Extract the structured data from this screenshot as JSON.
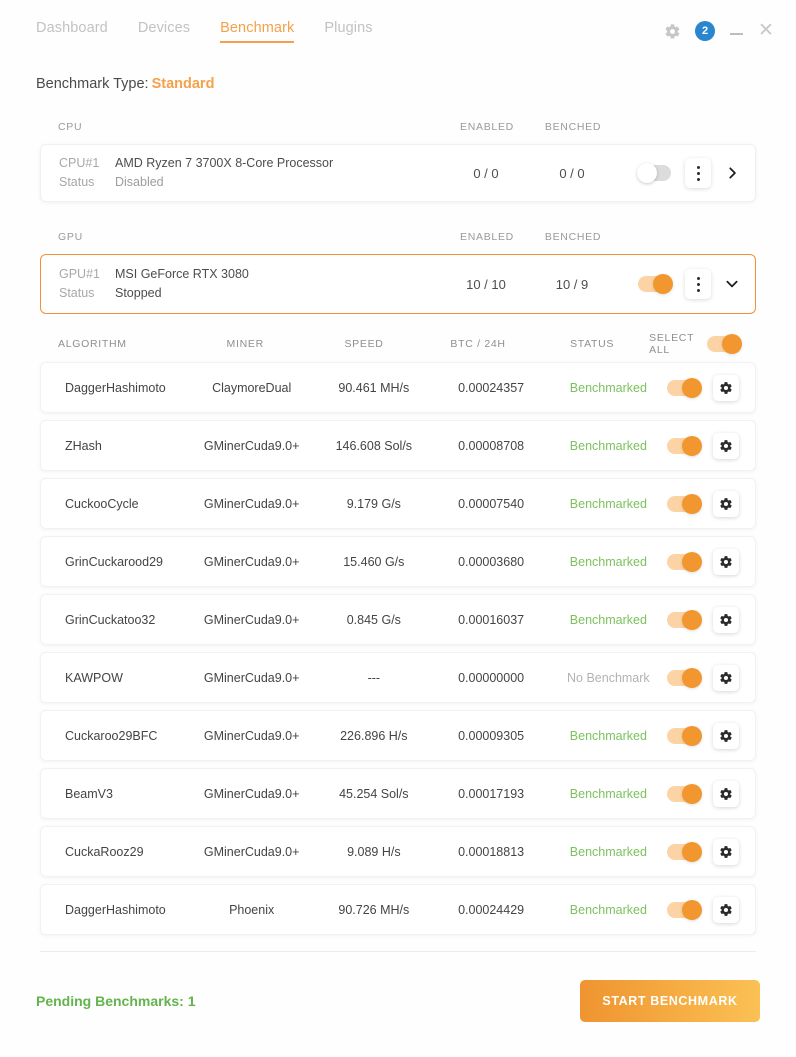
{
  "header": {
    "tabs": [
      {
        "label": "Dashboard",
        "active": false
      },
      {
        "label": "Devices",
        "active": false
      },
      {
        "label": "Benchmark",
        "active": true
      },
      {
        "label": "Plugins",
        "active": false
      }
    ],
    "settings_icon": "gear-icon",
    "notification_count": "2",
    "minimize_label": "",
    "close_label": "✕"
  },
  "benchmark_type": {
    "label": "Benchmark Type:",
    "value": "Standard"
  },
  "cpu_section": {
    "columns": {
      "name": "CPU",
      "enabled": "ENABLED",
      "benched": "BENCHED"
    },
    "device": {
      "id_key": "CPU#1",
      "id_value": "AMD Ryzen 7 3700X 8-Core Processor",
      "status_key": "Status",
      "status_value": "Disabled",
      "enabled": "0 / 0",
      "benched": "0 / 0",
      "toggle_on": false,
      "expanded": false
    }
  },
  "gpu_section": {
    "columns": {
      "name": "GPU",
      "enabled": "ENABLED",
      "benched": "BENCHED"
    },
    "device": {
      "id_key": "GPU#1",
      "id_value": "MSI GeForce RTX 3080",
      "status_key": "Status",
      "status_value": "Stopped",
      "enabled": "10 / 10",
      "benched": "10 / 9",
      "toggle_on": true,
      "expanded": true
    }
  },
  "algo_table": {
    "columns": {
      "algorithm": "ALGORITHM",
      "miner": "MINER",
      "speed": "SPEED",
      "btc": "BTC / 24H",
      "status": "STATUS",
      "select_all": "SELECT ALL"
    },
    "select_all_on": true,
    "rows": [
      {
        "algorithm": "DaggerHashimoto",
        "miner": "ClaymoreDual",
        "speed": "90.461 MH/s",
        "btc": "0.00024357",
        "status": "Benchmarked",
        "benchmarked": true,
        "enabled": true
      },
      {
        "algorithm": "ZHash",
        "miner": "GMinerCuda9.0+",
        "speed": "146.608 Sol/s",
        "btc": "0.00008708",
        "status": "Benchmarked",
        "benchmarked": true,
        "enabled": true
      },
      {
        "algorithm": "CuckooCycle",
        "miner": "GMinerCuda9.0+",
        "speed": "9.179 G/s",
        "btc": "0.00007540",
        "status": "Benchmarked",
        "benchmarked": true,
        "enabled": true
      },
      {
        "algorithm": "GrinCuckarood29",
        "miner": "GMinerCuda9.0+",
        "speed": "15.460 G/s",
        "btc": "0.00003680",
        "status": "Benchmarked",
        "benchmarked": true,
        "enabled": true
      },
      {
        "algorithm": "GrinCuckatoo32",
        "miner": "GMinerCuda9.0+",
        "speed": "0.845 G/s",
        "btc": "0.00016037",
        "status": "Benchmarked",
        "benchmarked": true,
        "enabled": true
      },
      {
        "algorithm": "KAWPOW",
        "miner": "GMinerCuda9.0+",
        "speed": "---",
        "btc": "0.00000000",
        "status": "No Benchmark",
        "benchmarked": false,
        "enabled": true
      },
      {
        "algorithm": "Cuckaroo29BFC",
        "miner": "GMinerCuda9.0+",
        "speed": "226.896 H/s",
        "btc": "0.00009305",
        "status": "Benchmarked",
        "benchmarked": true,
        "enabled": true
      },
      {
        "algorithm": "BeamV3",
        "miner": "GMinerCuda9.0+",
        "speed": "45.254 Sol/s",
        "btc": "0.00017193",
        "status": "Benchmarked",
        "benchmarked": true,
        "enabled": true
      },
      {
        "algorithm": "CuckaRooz29",
        "miner": "GMinerCuda9.0+",
        "speed": "9.089 H/s",
        "btc": "0.00018813",
        "status": "Benchmarked",
        "benchmarked": true,
        "enabled": true
      },
      {
        "algorithm": "DaggerHashimoto",
        "miner": "Phoenix",
        "speed": "90.726 MH/s",
        "btc": "0.00024429",
        "status": "Benchmarked",
        "benchmarked": true,
        "enabled": true
      }
    ]
  },
  "footer": {
    "pending_label": "Pending Benchmarks: 1",
    "start_button": "START BENCHMARK"
  },
  "colors": {
    "accent_orange": "#f5a04a",
    "accent_orange_dark": "#f0913a",
    "green_status": "#7cc25e",
    "green_pending": "#63b44c",
    "badge_blue": "#2a87cf",
    "muted_text": "#9a9a9a"
  }
}
